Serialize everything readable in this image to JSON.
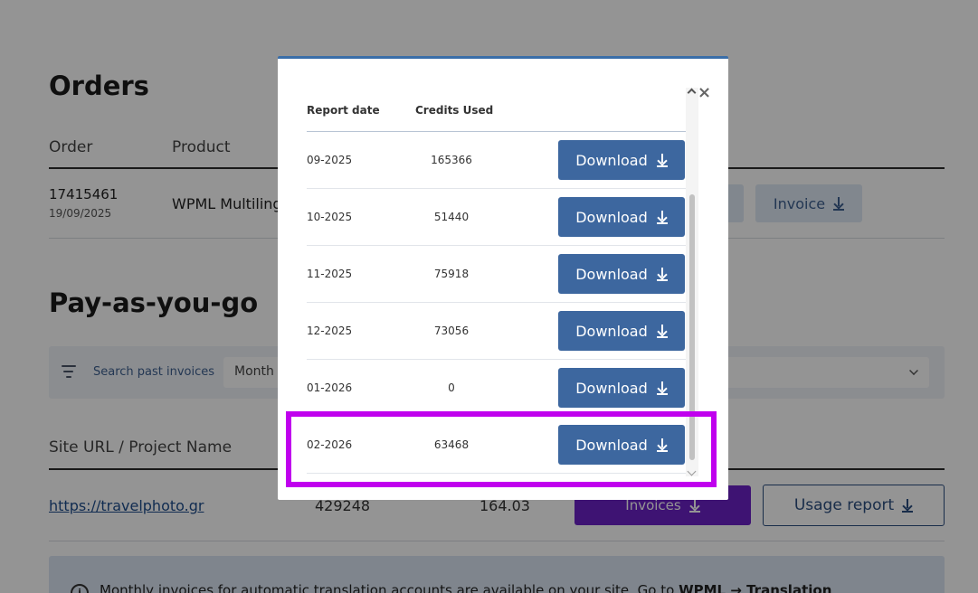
{
  "orders": {
    "title": "Orders",
    "columns": [
      "Order",
      "Product"
    ],
    "row": {
      "id": "17415461",
      "date": "19/09/2025",
      "product": "WPML Multilingual",
      "invoice_label": "Invoice"
    }
  },
  "payg": {
    "title": "Pay-as-you-go",
    "filter_label": "Search past invoices",
    "month_placeholder": "Month",
    "columns": [
      "Site URL / Project Name"
    ],
    "site": {
      "url": "https://travelphoto.gr",
      "credits": "429248",
      "amount": "164.03",
      "invoices_label": "Invoices",
      "usage_label": "Usage report"
    },
    "notice": {
      "text": "Monthly invoices for automatic translation accounts are available on your site. Go to",
      "link": "WPML → Translation"
    }
  },
  "modal": {
    "close": "×",
    "headers": {
      "date": "Report date",
      "credits": "Credits Used"
    },
    "download_label": "Download",
    "rows": [
      {
        "date": "09-2025",
        "credits": "165366"
      },
      {
        "date": "10-2025",
        "credits": "51440"
      },
      {
        "date": "11-2025",
        "credits": "75918"
      },
      {
        "date": "12-2025",
        "credits": "73056"
      },
      {
        "date": "01-2026",
        "credits": "0"
      },
      {
        "date": "02-2026",
        "credits": "63468"
      }
    ]
  },
  "colors": {
    "overlay": "#000000",
    "primary_button": "#3d679f",
    "accent_purple": "#6b21c7",
    "highlight": "#c000ee"
  }
}
